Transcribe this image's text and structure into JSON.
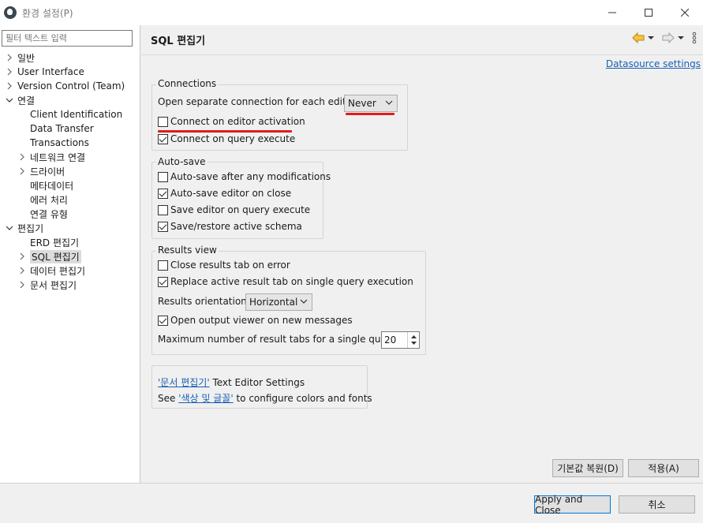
{
  "window": {
    "title": "환경 설정(P)",
    "icon": "dbeaver-beaver-icon"
  },
  "filter": {
    "placeholder": "필터 텍스트 입력"
  },
  "tree": {
    "items": [
      {
        "label": "일반",
        "arrow": "right"
      },
      {
        "label": "User Interface",
        "arrow": "right"
      },
      {
        "label": "Version Control (Team)",
        "arrow": "right"
      },
      {
        "label": "연결",
        "arrow": "down"
      },
      {
        "label": "Client Identification",
        "arrow": "none"
      },
      {
        "label": "Data Transfer",
        "arrow": "none"
      },
      {
        "label": "Transactions",
        "arrow": "none"
      },
      {
        "label": "네트워크 연결",
        "arrow": "right"
      },
      {
        "label": "드라이버",
        "arrow": "right"
      },
      {
        "label": "메타데이터",
        "arrow": "none"
      },
      {
        "label": "에러 처리",
        "arrow": "none"
      },
      {
        "label": "연결 유형",
        "arrow": "none"
      },
      {
        "label": "편집기",
        "arrow": "down"
      },
      {
        "label": "ERD 편집기",
        "arrow": "none"
      },
      {
        "label": "SQL 편집기",
        "arrow": "right",
        "selected": true
      },
      {
        "label": "데이터 편집기",
        "arrow": "right"
      },
      {
        "label": "문서 편집기",
        "arrow": "right"
      }
    ]
  },
  "page": {
    "title": "SQL 편집기",
    "datasource_link": "Datasource settings"
  },
  "connections": {
    "title": "Connections",
    "open_separate_label": "Open separate connection for each editor:",
    "open_separate_value": "Never",
    "connect_on_activation": "Connect on editor activation",
    "connect_on_activation_checked": false,
    "connect_on_query": "Connect on query execute",
    "connect_on_query_checked": true
  },
  "autosave": {
    "title": "Auto-save",
    "items": [
      {
        "label": "Auto-save after any modifications",
        "checked": false
      },
      {
        "label": "Auto-save editor on close",
        "checked": true
      },
      {
        "label": "Save editor on query execute",
        "checked": false
      },
      {
        "label": "Save/restore active schema",
        "checked": true
      }
    ]
  },
  "results": {
    "title": "Results view",
    "close_tab_on_error": "Close results tab on error",
    "close_tab_on_error_checked": false,
    "replace_active_tab": "Replace active result tab on single query execution",
    "replace_active_tab_checked": true,
    "orientation_label": "Results orientation:",
    "orientation_value": "Horizontal",
    "open_output_viewer": "Open output viewer on new messages",
    "open_output_viewer_checked": true,
    "max_tabs_label": "Maximum number of result tabs for a single query:",
    "max_tabs_value": "20"
  },
  "info_box": {
    "line1_link": "'문서 편집기'",
    "line1_text": " Text Editor Settings",
    "line2_prefix": "See ",
    "line2_link": "'색상 및 글꼴'",
    "line2_suffix": " to configure colors and fonts"
  },
  "buttons": {
    "restore_defaults": "기본값 복원(D)",
    "apply": "적용(A)",
    "apply_close": "Apply and Close",
    "cancel": "취소"
  },
  "annotation_color": "#e01c1c"
}
